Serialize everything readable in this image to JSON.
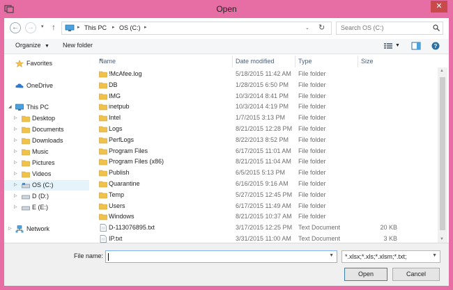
{
  "window": {
    "title": "Open",
    "close_glyph": "✕",
    "accent": "#e76da5"
  },
  "address": {
    "back_glyph": "←",
    "forward_glyph": "→",
    "recent_glyph": "▾",
    "up_glyph": "↑",
    "crumbs": [
      "This PC",
      "OS (C:)"
    ],
    "dropdown_glyph": "⌄",
    "refresh_glyph": "↻"
  },
  "search": {
    "placeholder": "Search OS (C:)"
  },
  "toolbar": {
    "organize": "Organize",
    "new_folder": "New folder"
  },
  "navpane": {
    "items": [
      {
        "label": "Favorites",
        "icon": "star-icon"
      },
      {
        "label": "OneDrive",
        "icon": "cloud-icon"
      },
      {
        "label": "This PC",
        "icon": "computer-icon"
      },
      {
        "label": "Desktop",
        "icon": "folder-icon"
      },
      {
        "label": "Documents",
        "icon": "folder-icon"
      },
      {
        "label": "Downloads",
        "icon": "folder-icon"
      },
      {
        "label": "Music",
        "icon": "folder-icon"
      },
      {
        "label": "Pictures",
        "icon": "folder-icon"
      },
      {
        "label": "Videos",
        "icon": "folder-icon"
      },
      {
        "label": "OS (C:)",
        "icon": "drive-icon"
      },
      {
        "label": "D (D:)",
        "icon": "drive-icon"
      },
      {
        "label": "E (E:)",
        "icon": "drive-icon"
      },
      {
        "label": "Network",
        "icon": "network-icon"
      }
    ]
  },
  "filelist": {
    "columns": [
      "Name",
      "Date modified",
      "Type",
      "Size"
    ],
    "rows": [
      {
        "name": "!McAfee.log",
        "date": "5/18/2015 11:42 AM",
        "type": "File folder",
        "size": ""
      },
      {
        "name": "DB",
        "date": "1/28/2015 6:50 PM",
        "type": "File folder",
        "size": ""
      },
      {
        "name": "IMG",
        "date": "10/3/2014 8:41 PM",
        "type": "File folder",
        "size": ""
      },
      {
        "name": "inetpub",
        "date": "10/3/2014 4:19 PM",
        "type": "File folder",
        "size": ""
      },
      {
        "name": "Intel",
        "date": "1/7/2015 3:13 PM",
        "type": "File folder",
        "size": ""
      },
      {
        "name": "Logs",
        "date": "8/21/2015 12:28 PM",
        "type": "File folder",
        "size": ""
      },
      {
        "name": "PerfLogs",
        "date": "8/22/2013 8:52 PM",
        "type": "File folder",
        "size": ""
      },
      {
        "name": "Program Files",
        "date": "6/17/2015 11:01 AM",
        "type": "File folder",
        "size": ""
      },
      {
        "name": "Program Files (x86)",
        "date": "8/21/2015 11:04 AM",
        "type": "File folder",
        "size": ""
      },
      {
        "name": "Publish",
        "date": "6/5/2015 5:13 PM",
        "type": "File folder",
        "size": ""
      },
      {
        "name": "Quarantine",
        "date": "6/16/2015 9:16 AM",
        "type": "File folder",
        "size": ""
      },
      {
        "name": "Temp",
        "date": "5/27/2015 12:45 PM",
        "type": "File folder",
        "size": ""
      },
      {
        "name": "Users",
        "date": "6/17/2015 11:49 AM",
        "type": "File folder",
        "size": ""
      },
      {
        "name": "Windows",
        "date": "8/21/2015 10:37 AM",
        "type": "File folder",
        "size": ""
      },
      {
        "name": "D-113076895.txt",
        "date": "3/17/2015 12:25 PM",
        "type": "Text Document",
        "size": "20 KB"
      },
      {
        "name": "IP.txt",
        "date": "3/31/2015 11:00 AM",
        "type": "Text Document",
        "size": "3 KB"
      }
    ]
  },
  "bottom": {
    "file_name_label": "File name:",
    "file_name_value": "",
    "filter_value": "*.xlsx;*.xls;*.xlsm;*.txt;",
    "open_label": "Open",
    "cancel_label": "Cancel"
  }
}
